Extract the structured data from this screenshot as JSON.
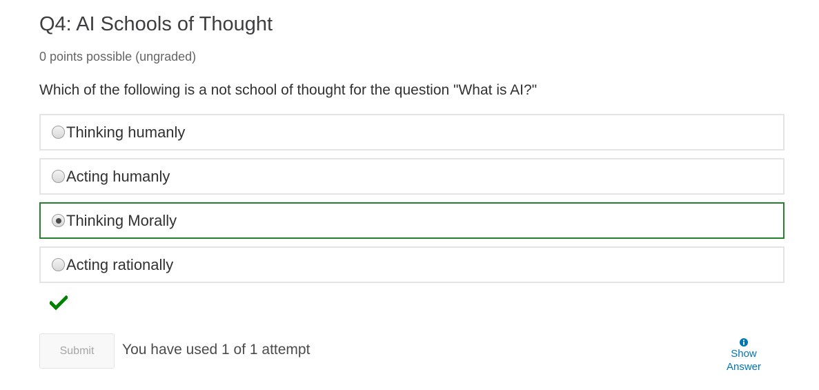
{
  "problem": {
    "title": "Q4: AI Schools of Thought",
    "points": "0 points possible (ungraded)",
    "prompt": "Which of the following is a not school of thought for the question \"What is AI?\""
  },
  "choices": [
    {
      "label": "Thinking humanly",
      "selected": false
    },
    {
      "label": "Acting humanly",
      "selected": false
    },
    {
      "label": "Thinking Morally",
      "selected": true
    },
    {
      "label": "Acting rationally",
      "selected": false
    }
  ],
  "status": {
    "icon": "checkmark-icon",
    "color": "#008100"
  },
  "actions": {
    "submit_label": "Submit",
    "attempts_text": "You have used 1 of 1 attempt",
    "show_answer_label": "Show Answer",
    "show_answer_icon": "info-icon"
  },
  "colors": {
    "selected_border": "#24812b",
    "link": "#0075b4"
  }
}
